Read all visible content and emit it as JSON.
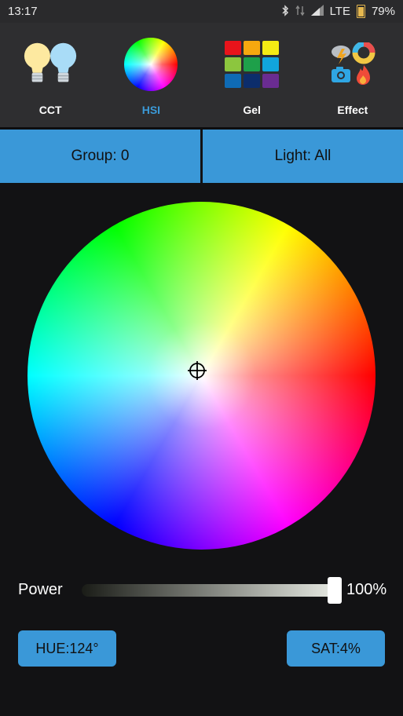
{
  "status_bar": {
    "time": "13:17",
    "network": "LTE",
    "battery": "79%",
    "icons": [
      "bluetooth-icon",
      "data-arrows-icon",
      "signal-icon",
      "battery-icon"
    ]
  },
  "toolbar": {
    "tabs": [
      {
        "label": "CCT",
        "icon": "bulbs-icon",
        "active": false
      },
      {
        "label": "HSI",
        "icon": "color-wheel-icon",
        "active": true
      },
      {
        "label": "Gel",
        "icon": "gel-grid-icon",
        "active": false
      },
      {
        "label": "Effect",
        "icon": "effects-icon",
        "active": false
      }
    ]
  },
  "selectors": {
    "group": "Group: 0",
    "light": "Light: All"
  },
  "power": {
    "label": "Power",
    "value_text": "100%",
    "level": 1.0
  },
  "hue_button": "HUE:124°",
  "sat_button": "SAT:4%",
  "colors": {
    "accent": "#3a98d8",
    "background": "#121214",
    "toolbar": "#2e2e30"
  }
}
